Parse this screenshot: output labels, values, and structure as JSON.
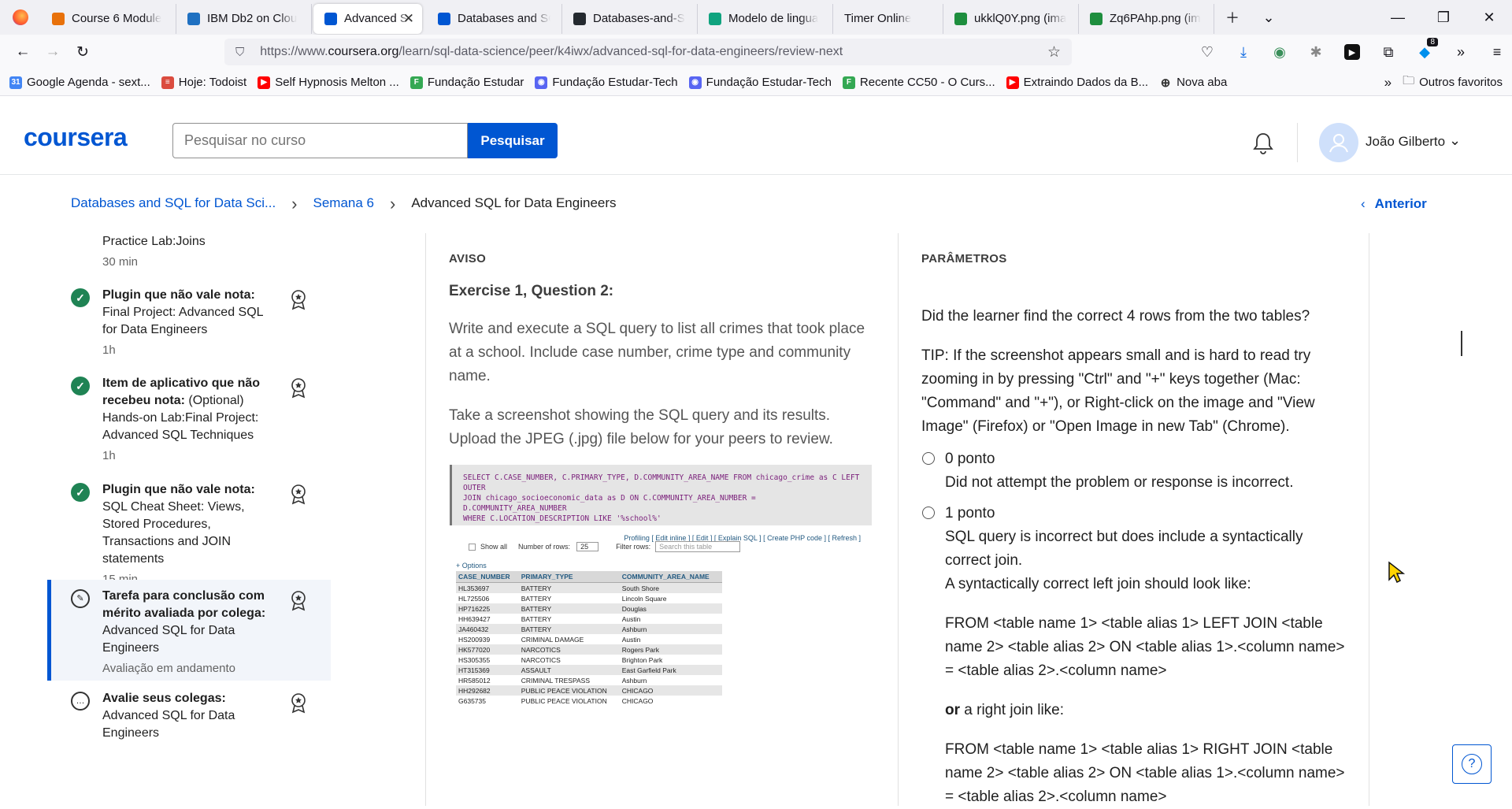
{
  "browser": {
    "tabs": [
      {
        "title": "Course 6 Module",
        "color": "#e8710a"
      },
      {
        "title": "IBM Db2 on Clou",
        "color": "#1f70c1"
      },
      {
        "title": "Advanced SQL",
        "color": "#0056d2"
      },
      {
        "title": "Databases and SQ",
        "color": "#0056d2"
      },
      {
        "title": "Databases-and-S",
        "color": "#24292f"
      },
      {
        "title": "Modelo de lingua",
        "color": "#10a37f"
      },
      {
        "title": "Timer Online",
        "color": ""
      },
      {
        "title": "ukklQ0Y.png (ima",
        "color": "#1e8e3e"
      },
      {
        "title": "Zq6PAhp.png (im",
        "color": "#1e8e3e"
      }
    ],
    "url_prefix": "https://www.",
    "url_domain": "coursera.org",
    "url_path": "/learn/sql-data-science/peer/k4iwx/advanced-sql-for-data-engineers/review-next",
    "extension_badge": "8",
    "bookmarks": [
      {
        "label": "Google Agenda - sext...",
        "color": "#4285f4",
        "glyph": "31"
      },
      {
        "label": "Hoje: Todoist",
        "color": "#db4c3f",
        "glyph": "≡"
      },
      {
        "label": "Self Hypnosis Melton ...",
        "color": "#ff0000",
        "glyph": "▶"
      },
      {
        "label": "Fundação Estudar",
        "color": "#34a853",
        "glyph": "F"
      },
      {
        "label": "Fundação Estudar-Tech",
        "color": "#5865f2",
        "glyph": "◉"
      },
      {
        "label": "Fundação Estudar-Tech",
        "color": "#5865f2",
        "glyph": "◉"
      },
      {
        "label": "Recente CC50 - O Curs...",
        "color": "#34a853",
        "glyph": "F"
      },
      {
        "label": "Extraindo Dados da B...",
        "color": "#ff0000",
        "glyph": "▶"
      },
      {
        "label": "Nova aba",
        "color": "",
        "glyph": "⊕"
      }
    ],
    "other_bookmarks": "Outros favoritos"
  },
  "header": {
    "logo": "coursera",
    "search_placeholder": "Pesquisar no curso",
    "search_button": "Pesquisar",
    "user_name": "João Gilberto"
  },
  "breadcrumb": {
    "items": [
      "Databases and SQL for Data Sci...",
      "Semana 6",
      "Advanced SQL for Data Engineers"
    ],
    "previous": "Anterior"
  },
  "sidebar": {
    "items": [
      {
        "title": "",
        "text": "Practice Lab:Joins",
        "meta": "30 min"
      },
      {
        "title": "Plugin que não vale nota:",
        "text": "Final Project: Advanced SQL for Data Engineers",
        "meta": "1h"
      },
      {
        "title": "Item de aplicativo que não recebeu nota:",
        "text": "(Optional) Hands-on Lab:Final Project: Advanced SQL Techniques",
        "meta": "1h"
      },
      {
        "title": "Plugin que não vale nota:",
        "text": "SQL Cheat Sheet: Views, Stored Procedures, Transactions and JOIN statements",
        "meta": "15 min"
      },
      {
        "title": "Tarefa para conclusão com mérito avaliada por colega:",
        "text": "Advanced SQL for Data Engineers",
        "meta": "Avaliação em andamento"
      },
      {
        "title": "Avalie seus colegas:",
        "text": "Advanced SQL for Data Engineers",
        "meta": ""
      }
    ]
  },
  "prompt": {
    "label": "AVISO",
    "question_title": "Exercise 1, Question 2:",
    "paragraph1": "Write and execute a SQL query to list all crimes that took place at a school. Include case number, crime type and community name.",
    "paragraph2": "Take a screenshot showing the SQL query and its results. Upload the JPEG (.jpg) file below for your peers to review."
  },
  "screenshot": {
    "sql_line1": "SELECT C.CASE_NUMBER, C.PRIMARY_TYPE, D.COMMUNITY_AREA_NAME FROM chicago_crime as C LEFT OUTER",
    "sql_line2": "JOIN chicago_socioeconomic_data as D ON C.COMMUNITY_AREA_NUMBER = D.COMMUNITY_AREA_NUMBER",
    "sql_line3": "WHERE C.LOCATION_DESCRIPTION LIKE '%school%'",
    "profiling": "Profiling [ Edit inline ] [ Edit ] [ Explain SQL ] [ Create PHP code ] [ Refresh ]",
    "show_all": "Show all",
    "number_of_rows_label": "Number of rows:",
    "rows_value": "25",
    "filter_label": "Filter rows:",
    "filter_placeholder": "Search this table",
    "options": "+ Options",
    "columns": [
      "CASE_NUMBER",
      "PRIMARY_TYPE",
      "COMMUNITY_AREA_NAME"
    ],
    "rows": [
      [
        "HL353697",
        "BATTERY",
        "South Shore"
      ],
      [
        "HL725506",
        "BATTERY",
        "Lincoln Square"
      ],
      [
        "HP716225",
        "BATTERY",
        "Douglas"
      ],
      [
        "HH639427",
        "BATTERY",
        "Austin"
      ],
      [
        "JA460432",
        "BATTERY",
        "Ashburn"
      ],
      [
        "HS200939",
        "CRIMINAL DAMAGE",
        "Austin"
      ],
      [
        "HK577020",
        "NARCOTICS",
        "Rogers Park"
      ],
      [
        "HS305355",
        "NARCOTICS",
        "Brighton Park"
      ],
      [
        "HT315369",
        "ASSAULT",
        "East Garfield Park"
      ],
      [
        "HR585012",
        "CRIMINAL TRESPASS",
        "Ashburn"
      ],
      [
        "HH292682",
        "PUBLIC PEACE VIOLATION",
        "CHICAGO"
      ],
      [
        "G635735",
        "PUBLIC PEACE VIOLATION",
        "CHICAGO"
      ]
    ]
  },
  "rubric": {
    "label": "PARÂMETROS",
    "question": "Did the learner find the correct 4 rows from the two tables?",
    "tip": "TIP: If the screenshot appears small and is hard to read try zooming in by pressing \"Ctrl\" and \"+\" keys together (Mac: \"Command\" and \"+\"), or Right-click on the image and \"View Image\" (Firefox) or \"Open Image in new Tab\" (Chrome).",
    "options": [
      {
        "points": "0 ponto",
        "desc": "Did not attempt the problem or response is incorrect."
      },
      {
        "points": "1 ponto",
        "desc": "SQL query is incorrect but does include a syntactically correct join."
      }
    ],
    "left_join_intro": "A syntactically correct left join should look like:",
    "left_join_code": "FROM <table name 1> <table alias 1> LEFT JOIN <table name 2> <table alias 2> ON <table alias 1>.<column name> = <table alias 2>.<column name>",
    "or_word": "or",
    "right_join_intro": "a right join like:",
    "right_join_code": "FROM <table name 1> <table alias 1> RIGHT JOIN <table name 2> <table alias 2> ON <table alias 1>.<column name> = <table alias 2>.<column name>"
  }
}
